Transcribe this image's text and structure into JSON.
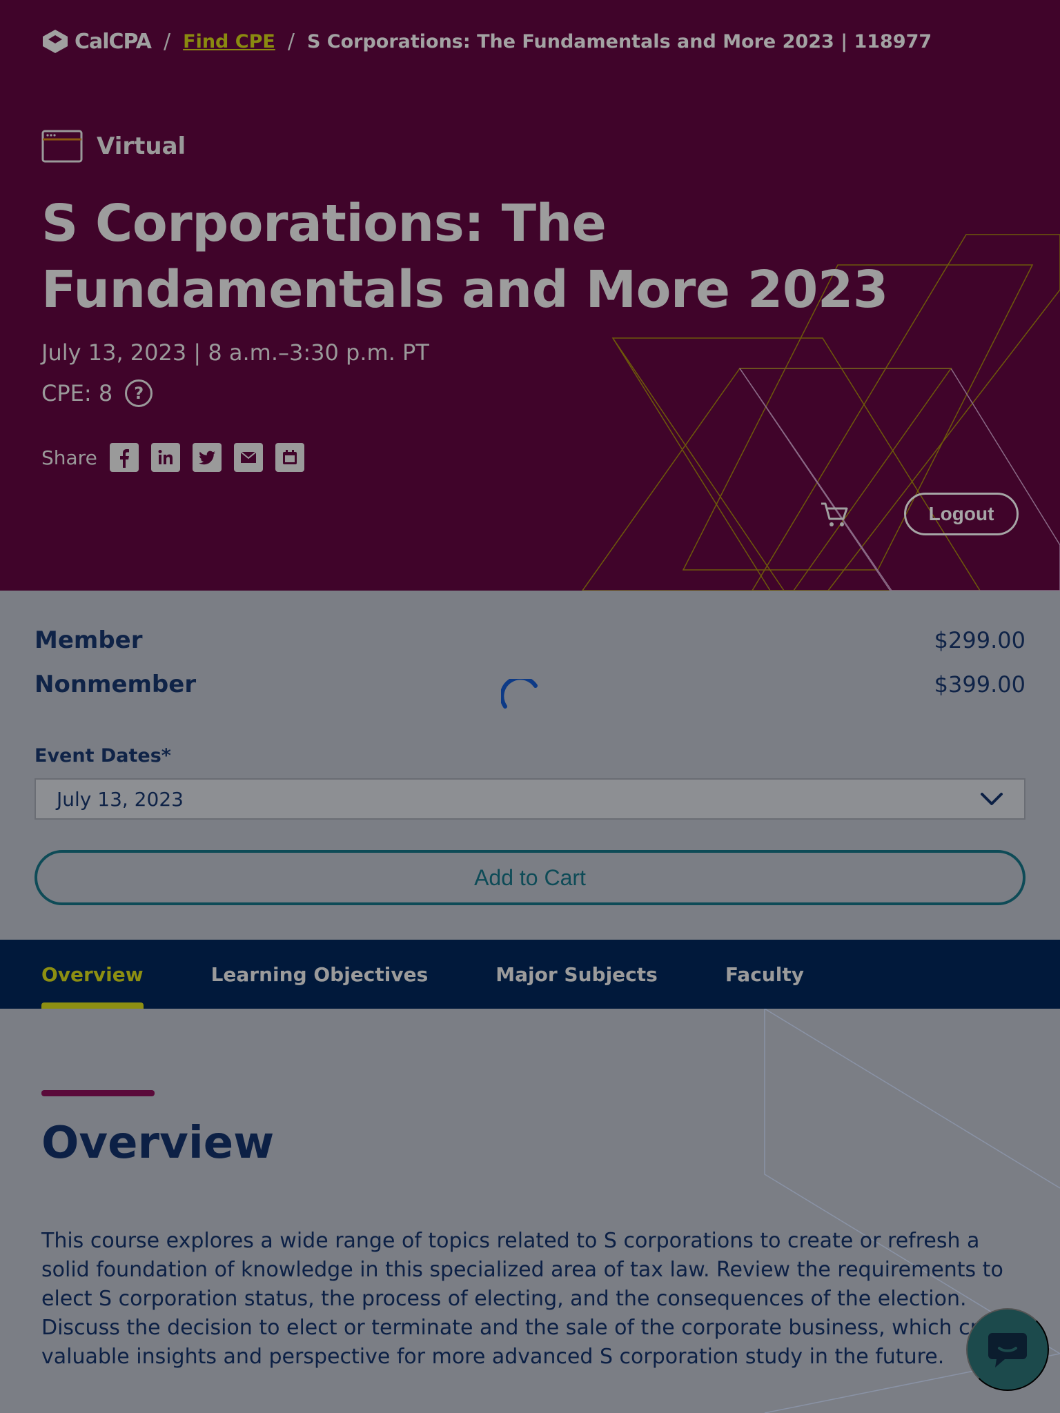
{
  "breadcrumb": {
    "logo_text": "CalCPA",
    "separator": "/",
    "link": "Find CPE",
    "current": "S Corporations: The Fundamentals and More 2023 | 118977"
  },
  "event": {
    "format": "Virtual",
    "title": "S Corporations: The Fundamentals and More 2023",
    "date": "July 13, 2023 | 8 a.m.–3:30 p.m. PT",
    "cpe": "CPE: 8",
    "help_glyph": "?",
    "share_label": "Share",
    "share_icons": [
      "facebook-icon",
      "linkedin-icon",
      "twitter-icon",
      "email-icon",
      "calendar-icon"
    ]
  },
  "header_actions": {
    "logout_label": "Logout"
  },
  "pricing": {
    "rows": [
      {
        "name": "Member",
        "price": "$299.00"
      },
      {
        "name": "Nonmember",
        "price": "$399.00"
      }
    ],
    "event_dates_label": "Event Dates*",
    "selected_date": "July 13, 2023",
    "add_to_cart_label": "Add to Cart"
  },
  "tabs": [
    {
      "label": "Overview",
      "active": true
    },
    {
      "label": "Learning Objectives",
      "active": false
    },
    {
      "label": "Major Subjects",
      "active": false
    },
    {
      "label": "Faculty",
      "active": false
    }
  ],
  "overview": {
    "heading": "Overview",
    "body": "This course explores a wide range of topics related to S corporations to create or refresh a solid foundation of knowledge in this specialized area of tax law. Review the requirements to elect S corporation status, the process of electing, and the consequences of the election. Discuss the decision to elect or terminate and the sale of the corporate business, which create valuable insights and perspective for more advanced S corporation study in the future."
  },
  "colors": {
    "hero_bg": "#40042a",
    "accent_olive": "#8d8f12",
    "navy": "#01193b",
    "teal": "#0e4b57",
    "overlay_gray": "#7b7e85"
  }
}
